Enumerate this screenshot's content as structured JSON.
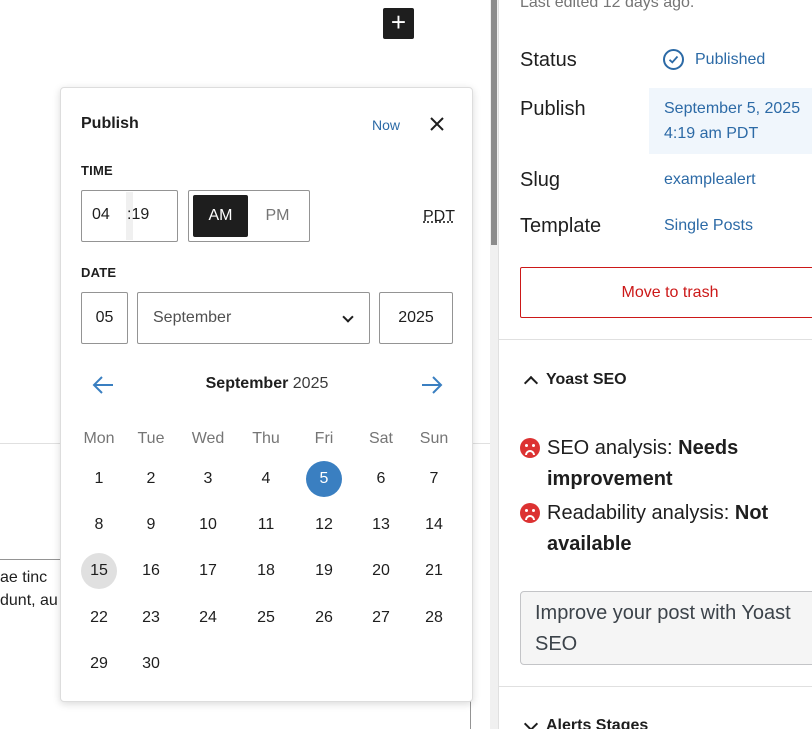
{
  "canvas": {
    "add_block_label": "+",
    "paragraph_lines": [
      "ae tinc",
      "dunt, au"
    ]
  },
  "sidebar": {
    "last_edited": "Last edited 12 days ago.",
    "status": {
      "label": "Status",
      "value": "Published"
    },
    "publish": {
      "label": "Publish",
      "date": "September 5, 2025",
      "time": "4:19 am PDT"
    },
    "slug": {
      "label": "Slug",
      "value": "examplealert"
    },
    "template": {
      "label": "Template",
      "value": "Single Posts"
    },
    "trash_label": "Move to trash",
    "yoast": {
      "title": "Yoast SEO",
      "seo_prefix": "SEO analysis: ",
      "seo_status_1": "Needs",
      "seo_status_2": "improvement",
      "readability_prefix": "Readability analysis: ",
      "readability_status_1": "Not",
      "readability_status_2": "available",
      "improve_line_1": "Improve your post with Yoast",
      "improve_line_2": "SEO"
    },
    "alerts_title": "Alerts Stages",
    "colors": {
      "link": "#2c6aa6",
      "danger": "#cc1818",
      "bad": "#dc3232"
    }
  },
  "popover": {
    "title": "Publish",
    "now_label": "Now",
    "time_label": "TIME",
    "hour": "04",
    "minute": "19",
    "am_label": "AM",
    "pm_label": "PM",
    "selected_period": "AM",
    "timezone": "PDT",
    "date_label": "DATE",
    "day": "05",
    "month": "September",
    "year": "2025",
    "calendar": {
      "month": "September",
      "year": "2025",
      "weekdays": [
        "Mon",
        "Tue",
        "Wed",
        "Thu",
        "Fri",
        "Sat",
        "Sun"
      ],
      "selected_day": 5,
      "today": 15,
      "days_in_month": 30,
      "first_weekday_index": 0
    },
    "colors": {
      "selected": "#3a7fc1",
      "today": "#e0e0e0"
    }
  }
}
